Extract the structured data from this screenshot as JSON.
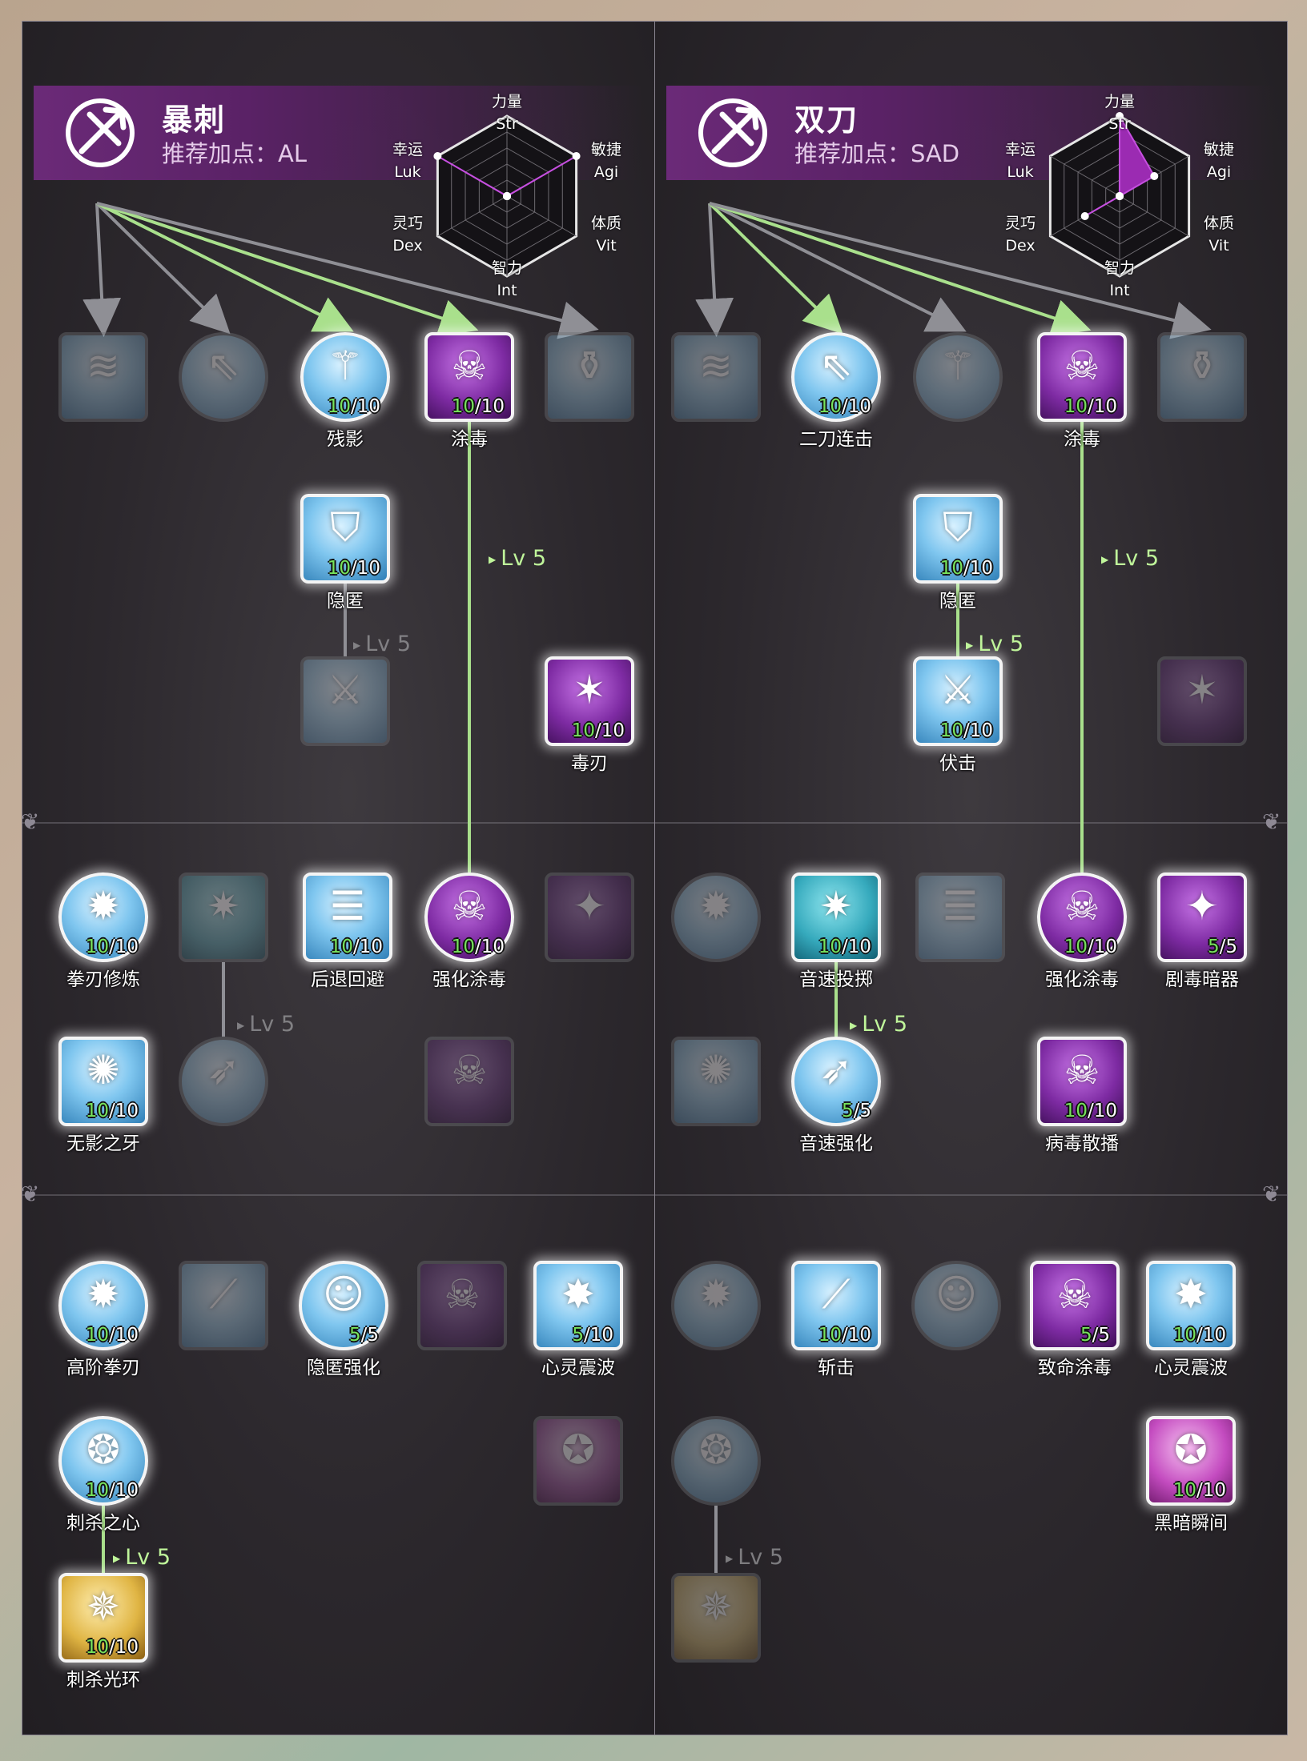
{
  "panels": [
    {
      "title": "暴刺",
      "recommend": "推荐加点：AL",
      "stats": {
        "str": {
          "cn": "力量",
          "en": "Str"
        },
        "agi": {
          "cn": "敏捷",
          "en": "Agi"
        },
        "vit": {
          "cn": "体质",
          "en": "Vit"
        },
        "int": {
          "cn": "智力",
          "en": "Int"
        },
        "dex": {
          "cn": "灵巧",
          "en": "Dex"
        },
        "luk": {
          "cn": "幸运",
          "en": "Luk"
        }
      },
      "stat_levels": {
        "str": 0.0,
        "agi": 1.0,
        "vit": 0.0,
        "int": 0.0,
        "dex": 0.0,
        "luk": 1.0
      },
      "skills": [
        {
          "id": "l1",
          "name": "",
          "level": "",
          "max": "",
          "active": false,
          "shape": "sq",
          "color": "blue",
          "glyph": "wind-slash-icon"
        },
        {
          "id": "l2",
          "name": "",
          "level": "",
          "max": "",
          "active": false,
          "shape": "rd",
          "color": "blue",
          "glyph": "double-arrow-icon"
        },
        {
          "id": "l3",
          "name": "残影",
          "level": "10",
          "max": "10",
          "active": true,
          "shape": "rd",
          "color": "blue",
          "glyph": "afterimage-icon"
        },
        {
          "id": "l4",
          "name": "涂毒",
          "level": "10",
          "max": "10",
          "active": true,
          "shape": "sq",
          "color": "purple",
          "glyph": "poison-blade-icon"
        },
        {
          "id": "l5",
          "name": "",
          "level": "",
          "max": "",
          "active": false,
          "shape": "sq",
          "color": "blue",
          "glyph": "potion-jar-icon"
        },
        {
          "id": "l6",
          "name": "隐匿",
          "level": "10",
          "max": "10",
          "active": true,
          "shape": "sq",
          "color": "blue",
          "glyph": "cloak-icon"
        },
        {
          "id": "l7",
          "name": "",
          "level": "",
          "max": "",
          "active": false,
          "shape": "sq",
          "color": "blue",
          "glyph": "backstab-icon"
        },
        {
          "id": "l8",
          "name": "毒刃",
          "level": "10",
          "max": "10",
          "active": true,
          "shape": "sq",
          "color": "purple",
          "glyph": "venom-edge-icon"
        },
        {
          "id": "l9",
          "name": "拳刃修炼",
          "level": "10",
          "max": "10",
          "active": true,
          "shape": "rd",
          "color": "blue",
          "glyph": "katar-icon"
        },
        {
          "id": "l10",
          "name": "",
          "level": "",
          "max": "",
          "active": false,
          "shape": "sq",
          "color": "teal",
          "glyph": "throw-burst-icon"
        },
        {
          "id": "l11",
          "name": "后退回避",
          "level": "10",
          "max": "10",
          "active": true,
          "shape": "sq",
          "color": "blue",
          "glyph": "dodge-icon"
        },
        {
          "id": "l12",
          "name": "强化涂毒",
          "level": "10",
          "max": "10",
          "active": true,
          "shape": "rd",
          "color": "purple",
          "glyph": "enhanced-poison-icon"
        },
        {
          "id": "l13",
          "name": "",
          "level": "",
          "max": "",
          "active": false,
          "shape": "sq",
          "color": "purple",
          "glyph": "poison-dart-icon"
        },
        {
          "id": "l14",
          "name": "无影之牙",
          "level": "10",
          "max": "10",
          "active": true,
          "shape": "sq",
          "color": "blue",
          "glyph": "shadow-fang-icon"
        },
        {
          "id": "l15",
          "name": "",
          "level": "",
          "max": "",
          "active": false,
          "shape": "rd",
          "color": "blue",
          "glyph": "sonic-icon"
        },
        {
          "id": "l16",
          "name": "",
          "level": "",
          "max": "",
          "active": false,
          "shape": "sq",
          "color": "purple",
          "glyph": "skull-icon"
        },
        {
          "id": "l17",
          "name": "高阶拳刃",
          "level": "10",
          "max": "10",
          "active": true,
          "shape": "rd",
          "color": "blue",
          "glyph": "katar-icon"
        },
        {
          "id": "l18",
          "name": "",
          "level": "",
          "max": "",
          "active": false,
          "shape": "sq",
          "color": "blue",
          "glyph": "slash-icon"
        },
        {
          "id": "l19",
          "name": "隐匿强化",
          "level": "5",
          "max": "5",
          "active": true,
          "shape": "rd",
          "color": "blue",
          "glyph": "stealth-face-icon"
        },
        {
          "id": "l20",
          "name": "",
          "level": "",
          "max": "",
          "active": false,
          "shape": "sq",
          "color": "purple",
          "glyph": "lethal-poison-icon"
        },
        {
          "id": "l21",
          "name": "心灵震波",
          "level": "5",
          "max": "10",
          "active": true,
          "shape": "sq",
          "color": "blue",
          "glyph": "mind-wave-icon"
        },
        {
          "id": "l22",
          "name": "刺杀之心",
          "level": "10",
          "max": "10",
          "active": true,
          "shape": "rd",
          "color": "blue",
          "glyph": "heart-icon"
        },
        {
          "id": "l23",
          "name": "",
          "level": "",
          "max": "",
          "active": false,
          "shape": "sq",
          "color": "magenta",
          "glyph": "dark-blink-icon"
        },
        {
          "id": "l24",
          "name": "刺杀光环",
          "level": "10",
          "max": "10",
          "active": true,
          "shape": "sq",
          "color": "gold",
          "glyph": "aura-icon"
        }
      ],
      "requirements": [
        {
          "text": "Lv 5",
          "active": true
        },
        {
          "text": "Lv 5",
          "active": false
        },
        {
          "text": "Lv 5",
          "active": false
        },
        {
          "text": "Lv 5",
          "active": true
        }
      ]
    },
    {
      "title": "双刀",
      "recommend": "推荐加点：SAD",
      "stats": {
        "str": {
          "cn": "力量",
          "en": "Str"
        },
        "agi": {
          "cn": "敏捷",
          "en": "Agi"
        },
        "vit": {
          "cn": "体质",
          "en": "Vit"
        },
        "int": {
          "cn": "智力",
          "en": "Int"
        },
        "dex": {
          "cn": "灵巧",
          "en": "Dex"
        },
        "luk": {
          "cn": "幸运",
          "en": "Luk"
        }
      },
      "stat_levels": {
        "str": 1.0,
        "agi": 0.5,
        "vit": 0.0,
        "int": 0.0,
        "dex": 0.5,
        "luk": 0.0
      },
      "skills": [
        {
          "id": "r1",
          "name": "",
          "level": "",
          "max": "",
          "active": false,
          "shape": "sq",
          "color": "blue",
          "glyph": "wind-slash-icon"
        },
        {
          "id": "r2",
          "name": "二刀连击",
          "level": "10",
          "max": "10",
          "active": true,
          "shape": "rd",
          "color": "blue",
          "glyph": "double-arrow-icon"
        },
        {
          "id": "r3",
          "name": "",
          "level": "",
          "max": "",
          "active": false,
          "shape": "rd",
          "color": "blue",
          "glyph": "afterimage-icon"
        },
        {
          "id": "r4",
          "name": "涂毒",
          "level": "10",
          "max": "10",
          "active": true,
          "shape": "sq",
          "color": "purple",
          "glyph": "poison-blade-icon"
        },
        {
          "id": "r5",
          "name": "",
          "level": "",
          "max": "",
          "active": false,
          "shape": "sq",
          "color": "blue",
          "glyph": "potion-jar-icon"
        },
        {
          "id": "r6",
          "name": "隐匿",
          "level": "10",
          "max": "10",
          "active": true,
          "shape": "sq",
          "color": "blue",
          "glyph": "cloak-icon"
        },
        {
          "id": "r7",
          "name": "伏击",
          "level": "10",
          "max": "10",
          "active": true,
          "shape": "sq",
          "color": "blue",
          "glyph": "backstab-icon"
        },
        {
          "id": "r8",
          "name": "",
          "level": "",
          "max": "",
          "active": false,
          "shape": "sq",
          "color": "purple",
          "glyph": "venom-edge-icon"
        },
        {
          "id": "r9",
          "name": "",
          "level": "",
          "max": "",
          "active": false,
          "shape": "rd",
          "color": "blue",
          "glyph": "katar-icon"
        },
        {
          "id": "r10",
          "name": "音速投掷",
          "level": "10",
          "max": "10",
          "active": true,
          "shape": "sq",
          "color": "teal",
          "glyph": "throw-burst-icon"
        },
        {
          "id": "r11",
          "name": "",
          "level": "",
          "max": "",
          "active": false,
          "shape": "sq",
          "color": "blue",
          "glyph": "dodge-icon"
        },
        {
          "id": "r12",
          "name": "强化涂毒",
          "level": "10",
          "max": "10",
          "active": true,
          "shape": "rd",
          "color": "purple",
          "glyph": "enhanced-poison-icon"
        },
        {
          "id": "r13",
          "name": "剧毒暗器",
          "level": "5",
          "max": "5",
          "active": true,
          "shape": "sq",
          "color": "purple",
          "glyph": "poison-dart-icon"
        },
        {
          "id": "r14",
          "name": "",
          "level": "",
          "max": "",
          "active": false,
          "shape": "sq",
          "color": "blue",
          "glyph": "shadow-fang-icon"
        },
        {
          "id": "r15",
          "name": "音速强化",
          "level": "5",
          "max": "5",
          "active": true,
          "shape": "rd",
          "color": "blue",
          "glyph": "sonic-icon"
        },
        {
          "id": "r16",
          "name": "病毒散播",
          "level": "10",
          "max": "10",
          "active": true,
          "shape": "sq",
          "color": "purple",
          "glyph": "skull-icon"
        },
        {
          "id": "r17",
          "name": "",
          "level": "",
          "max": "",
          "active": false,
          "shape": "rd",
          "color": "blue",
          "glyph": "katar-icon"
        },
        {
          "id": "r18",
          "name": "斩击",
          "level": "10",
          "max": "10",
          "active": true,
          "shape": "sq",
          "color": "blue",
          "glyph": "slash-icon"
        },
        {
          "id": "r19",
          "name": "",
          "level": "",
          "max": "",
          "active": false,
          "shape": "rd",
          "color": "blue",
          "glyph": "stealth-face-icon"
        },
        {
          "id": "r20",
          "name": "致命涂毒",
          "level": "5",
          "max": "5",
          "active": true,
          "shape": "sq",
          "color": "purple",
          "glyph": "lethal-poison-icon"
        },
        {
          "id": "r21",
          "name": "心灵震波",
          "level": "10",
          "max": "10",
          "active": true,
          "shape": "sq",
          "color": "blue",
          "glyph": "mind-wave-icon"
        },
        {
          "id": "r22",
          "name": "",
          "level": "",
          "max": "",
          "active": false,
          "shape": "rd",
          "color": "blue",
          "glyph": "heart-icon"
        },
        {
          "id": "r23",
          "name": "黑暗瞬间",
          "level": "10",
          "max": "10",
          "active": true,
          "shape": "sq",
          "color": "magenta",
          "glyph": "dark-blink-icon"
        },
        {
          "id": "r24",
          "name": "",
          "level": "",
          "max": "",
          "active": false,
          "shape": "sq",
          "color": "gold",
          "glyph": "aura-icon"
        }
      ],
      "requirements": [
        {
          "text": "Lv 5",
          "active": true
        },
        {
          "text": "Lv 5",
          "active": true
        },
        {
          "text": "Lv 5",
          "active": true
        },
        {
          "text": "Lv 5",
          "active": false
        }
      ]
    }
  ],
  "colors": {
    "active_line": "#a9e08c",
    "inactive_line": "#8f8f95",
    "level_current": "#77e35c",
    "banner": "#6b2a78"
  }
}
